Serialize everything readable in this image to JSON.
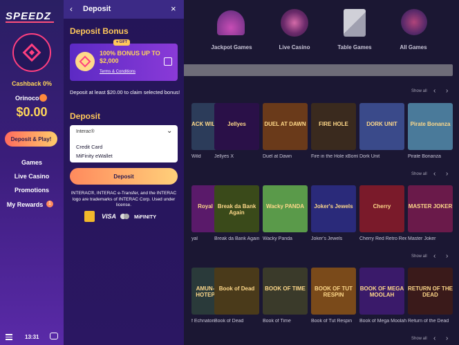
{
  "sidebar": {
    "logo": "SPEEDZ",
    "cashback": "Cashback 0%",
    "username": "Orinoco",
    "balance": "$0.00",
    "deposit_play": "Deposit & Play!",
    "nav": [
      "Games",
      "Live Casino",
      "Promotions",
      "My Rewards"
    ],
    "rewards_badge": "1",
    "clock": "13:31"
  },
  "categories": [
    "Jackpot Games",
    "Live Casino",
    "Table Games",
    "All Games"
  ],
  "rows": [
    {
      "show_all": "Show all",
      "tiles": [
        {
          "label": "Wild",
          "art": "ACK WILD",
          "color": "#2c3c5a"
        },
        {
          "label": "Jellyes X",
          "art": "Jellyes",
          "color": "#2a1048"
        },
        {
          "label": "Duel at Dawn",
          "art": "DUEL AT DAWN",
          "color": "#6a3a1a"
        },
        {
          "label": "Fire in the Hole xBomb",
          "art": "FIRE HOLE",
          "color": "#3a2a1e"
        },
        {
          "label": "Dork Unit",
          "art": "DORK UNIT",
          "color": "#3a4a8a"
        },
        {
          "label": "Pirate Bonanza",
          "art": "Pirate Bonanza",
          "color": "#4a7a9a"
        }
      ]
    },
    {
      "show_all": "Show all",
      "tiles": [
        {
          "label": "yal",
          "art": "Royal",
          "color": "#5a1a6a"
        },
        {
          "label": "Break da Bank Again",
          "art": "Break da Bank Again",
          "color": "#3a4a1a"
        },
        {
          "label": "Wacky Panda",
          "art": "Wacky PANDA",
          "color": "#5a9a4a"
        },
        {
          "label": "Joker's Jewels",
          "art": "Joker's Jewels",
          "color": "#2a2a7a"
        },
        {
          "label": "Cherry Red Retro Reels",
          "art": "Cherry",
          "color": "#7a1a2a"
        },
        {
          "label": "Master Joker",
          "art": "MASTER JOKER",
          "color": "#6a1a4a"
        }
      ]
    },
    {
      "show_all": "Show all",
      "tiles": [
        {
          "label": "f Echnaton",
          "art": "AMUN-HOTEP",
          "color": "#2a3a3a"
        },
        {
          "label": "Book of Dead",
          "art": "Book of Dead",
          "color": "#4a3a1a"
        },
        {
          "label": "Book of Time",
          "art": "BOOK OF TIME",
          "color": "#3a3a2a"
        },
        {
          "label": "Book of Tut Respin",
          "art": "BOOK OF TUT RESPIN",
          "color": "#7a4a1a"
        },
        {
          "label": "Book of Mega Moolah",
          "art": "BOOK OF MEGA MOOLAH",
          "color": "#3a1a6a"
        },
        {
          "label": "Return of the Dead",
          "art": "RETURN OF THE DEAD",
          "color": "#3a1a1a"
        }
      ]
    },
    {
      "show_all": "Show all"
    }
  ],
  "panel": {
    "title": "Deposit",
    "bonus_section": "Deposit Bonus",
    "bonus_tag": "♥ GIFT",
    "bonus_text": "100% BONUS UP TO $2,000",
    "bonus_terms": "Terms & Conditions",
    "info": "Deposit at least $20.00 to claim selected bonus!",
    "deposit_section": "Deposit",
    "method_selected": "Interac®",
    "method_options": [
      "Credit Card",
      "MiFinity eWallet"
    ],
    "deposit_button": "Deposit",
    "legal": "INTERAC®, INTERAC e-Transfer, and the INTERAC logo are trademarks of INTERAC Corp. Used under license.",
    "payments": {
      "visa": "VISA",
      "mifinity": "MiFINITY"
    }
  },
  "colors": {
    "accent": "#ffc85a",
    "brand_pink": "#ff3f7f",
    "panel_bg": "#241557"
  }
}
